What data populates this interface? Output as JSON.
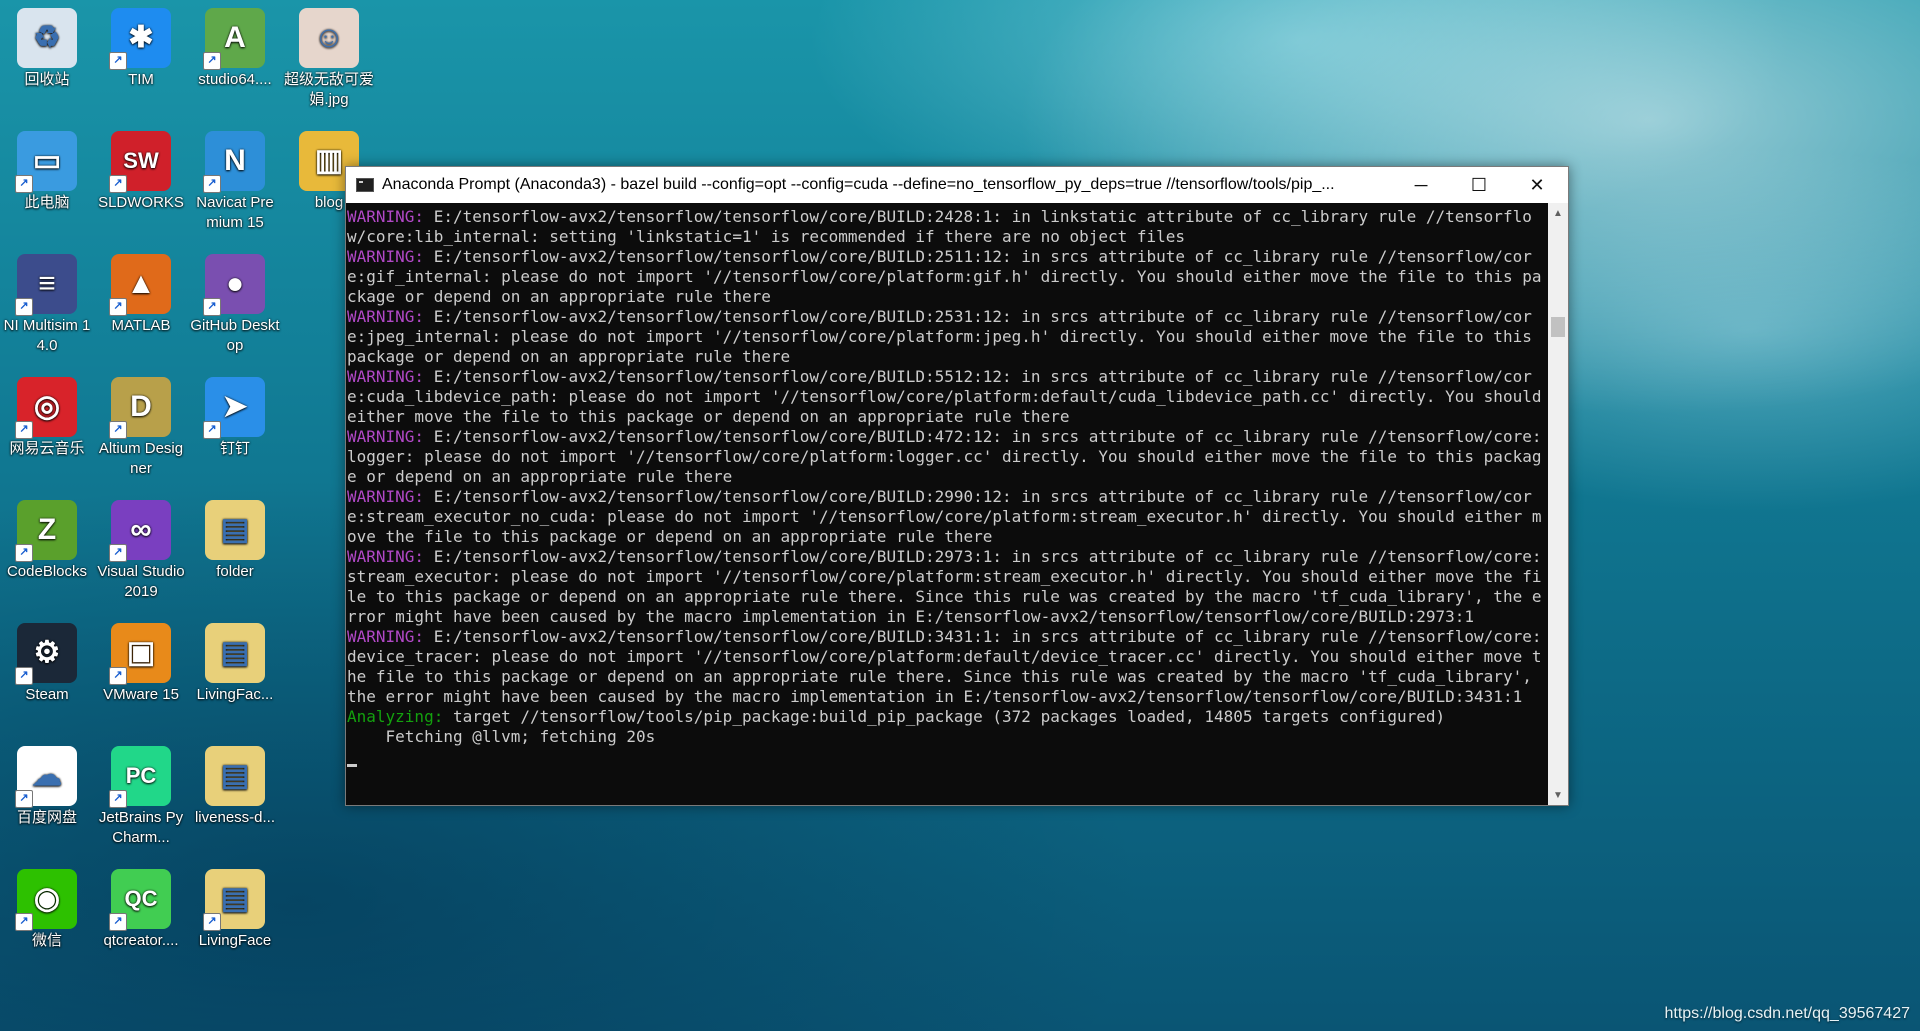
{
  "desktop": {
    "icons": [
      {
        "label": "回收站",
        "icon": "recycle-bin-icon",
        "color": "#d9e4ee",
        "glyph": "♻"
      },
      {
        "label": "TIM",
        "icon": "tim-icon",
        "color": "#1e8cf0",
        "glyph": "✱"
      },
      {
        "label": "studio64....",
        "icon": "android-studio-icon",
        "color": "#5fa84a",
        "glyph": "A"
      },
      {
        "label": "超级无敌可爱娟.jpg",
        "icon": "photo-file-icon",
        "color": "#e6d6cc",
        "glyph": "☺"
      },
      {
        "label": "此电脑",
        "icon": "this-pc-icon",
        "color": "#3a9be0",
        "glyph": "▭"
      },
      {
        "label": "SLDWORKS",
        "icon": "solidworks-icon",
        "color": "#d0202a",
        "glyph": "SW"
      },
      {
        "label": "Navicat Premium 15",
        "icon": "navicat-icon",
        "color": "#2d8fd8",
        "glyph": "N"
      },
      {
        "label": "blog",
        "icon": "blog-folder-icon",
        "color": "#e8b93a",
        "glyph": "▥"
      },
      {
        "label": "NI Multisim 14.0",
        "icon": "multisim-icon",
        "color": "#3c4c8c",
        "glyph": "≡"
      },
      {
        "label": "MATLAB",
        "icon": "matlab-icon",
        "color": "#e06a1a",
        "glyph": "▲"
      },
      {
        "label": "GitHub Desktop",
        "icon": "github-desktop-icon",
        "color": "#7a4fb0",
        "glyph": "●"
      },
      {
        "label": "网易云音乐",
        "icon": "netease-music-icon",
        "color": "#d8232a",
        "glyph": "◎"
      },
      {
        "label": "Altium Designer",
        "icon": "altium-icon",
        "color": "#b8a04a",
        "glyph": "D"
      },
      {
        "label": "钉钉",
        "icon": "dingtalk-icon",
        "color": "#2a8fe8",
        "glyph": "➤"
      },
      {
        "label": "CodeBlocks",
        "icon": "codeblocks-icon",
        "color": "#5aa02c",
        "glyph": "Z"
      },
      {
        "label": "Visual Studio 2019",
        "icon": "visual-studio-icon",
        "color": "#7a3fc0",
        "glyph": "∞"
      },
      {
        "label": "folder",
        "icon": "folder-icon",
        "color": "#e8d07a",
        "glyph": "▤"
      },
      {
        "label": "Steam",
        "icon": "steam-icon",
        "color": "#1b2838",
        "glyph": "⚙"
      },
      {
        "label": "VMware 15",
        "icon": "vmware-icon",
        "color": "#e88a1a",
        "glyph": "▣"
      },
      {
        "label": "LivingFac...",
        "icon": "livingface-folder-icon",
        "color": "#e8d07a",
        "glyph": "▤"
      },
      {
        "label": "百度网盘",
        "icon": "baidu-netdisk-icon",
        "color": "#ffffff",
        "glyph": "☁"
      },
      {
        "label": "JetBrains PyCharm...",
        "icon": "pycharm-icon",
        "color": "#21d789",
        "glyph": "PC"
      },
      {
        "label": "liveness-d...",
        "icon": "liveness-folder-icon",
        "color": "#e8d07a",
        "glyph": "▤"
      },
      {
        "label": "微信",
        "icon": "wechat-icon",
        "color": "#2dc100",
        "glyph": "◉"
      },
      {
        "label": "qtcreator....",
        "icon": "qtcreator-icon",
        "color": "#41cd52",
        "glyph": "QC"
      },
      {
        "label": "LivingFace",
        "icon": "livingface-icon",
        "color": "#e8d07a",
        "glyph": "▤"
      }
    ]
  },
  "window": {
    "title": "Anaconda Prompt (Anaconda3) - bazel  build --config=opt --config=cuda --define=no_tensorflow_py_deps=true //tensorflow/tools/pip_...",
    "minimize": "─",
    "maximize": "☐",
    "close": "✕",
    "lines": [
      {
        "k": "WARNING:",
        "t": " E:/tensorflow-avx2/tensorflow/tensorflow/core/BUILD:2428:1: in linkstatic attribute of cc_library rule //tensorflow/core:lib_internal: setting 'linkstatic=1' is recommended if there are no object files"
      },
      {
        "k": "WARNING:",
        "t": " E:/tensorflow-avx2/tensorflow/tensorflow/core/BUILD:2511:12: in srcs attribute of cc_library rule //tensorflow/core:gif_internal: please do not import '//tensorflow/core/platform:gif.h' directly. You should either move the file to this package or depend on an appropriate rule there"
      },
      {
        "k": "WARNING:",
        "t": " E:/tensorflow-avx2/tensorflow/tensorflow/core/BUILD:2531:12: in srcs attribute of cc_library rule //tensorflow/core:jpeg_internal: please do not import '//tensorflow/core/platform:jpeg.h' directly. You should either move the file to this package or depend on an appropriate rule there"
      },
      {
        "k": "WARNING:",
        "t": " E:/tensorflow-avx2/tensorflow/tensorflow/core/BUILD:5512:12: in srcs attribute of cc_library rule //tensorflow/core:cuda_libdevice_path: please do not import '//tensorflow/core/platform:default/cuda_libdevice_path.cc' directly. You should either move the file to this package or depend on an appropriate rule there"
      },
      {
        "k": "WARNING:",
        "t": " E:/tensorflow-avx2/tensorflow/tensorflow/core/BUILD:472:12: in srcs attribute of cc_library rule //tensorflow/core:logger: please do not import '//tensorflow/core/platform:logger.cc' directly. You should either move the file to this package or depend on an appropriate rule there"
      },
      {
        "k": "WARNING:",
        "t": " E:/tensorflow-avx2/tensorflow/tensorflow/core/BUILD:2990:12: in srcs attribute of cc_library rule //tensorflow/core:stream_executor_no_cuda: please do not import '//tensorflow/core/platform:stream_executor.h' directly. You should either move the file to this package or depend on an appropriate rule there"
      },
      {
        "k": "WARNING:",
        "t": " E:/tensorflow-avx2/tensorflow/tensorflow/core/BUILD:2973:1: in srcs attribute of cc_library rule //tensorflow/core:stream_executor: please do not import '//tensorflow/core/platform:stream_executor.h' directly. You should either move the file to this package or depend on an appropriate rule there. Since this rule was created by the macro 'tf_cuda_library', the error might have been caused by the macro implementation in E:/tensorflow-avx2/tensorflow/tensorflow/core/BUILD:2973:1"
      },
      {
        "k": "WARNING:",
        "t": " E:/tensorflow-avx2/tensorflow/tensorflow/core/BUILD:3431:1: in srcs attribute of cc_library rule //tensorflow/core:device_tracer: please do not import '//tensorflow/core/platform:default/device_tracer.cc' directly. You should either move the file to this package or depend on an appropriate rule there. Since this rule was created by the macro 'tf_cuda_library', the error might have been caused by the macro implementation in E:/tensorflow-avx2/tensorflow/tensorflow/core/BUILD:3431:1"
      },
      {
        "k": "Analyzing:",
        "t": " target //tensorflow/tools/pip_package:build_pip_package (372 packages loaded, 14805 targets configured)"
      },
      {
        "k": "",
        "t": "    Fetching @llvm; fetching 20s"
      }
    ]
  },
  "watermark": "https://blog.csdn.net/qq_39567427"
}
